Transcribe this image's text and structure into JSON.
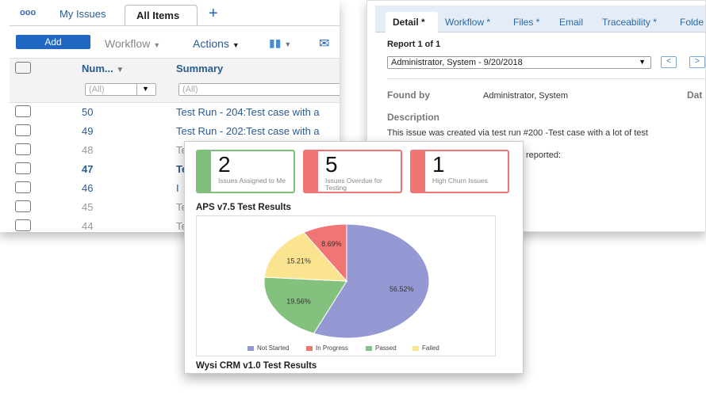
{
  "issues": {
    "tabs": [
      {
        "label": "ooo"
      },
      {
        "label": "My Issues"
      },
      {
        "label": "All Items"
      },
      {
        "label": "+"
      }
    ],
    "toolbar": {
      "add": "Add",
      "workflow": "Workflow",
      "actions": "Actions"
    },
    "columns": {
      "number": "Num...",
      "summary": "Summary"
    },
    "filters": {
      "number": "(All)",
      "summary": "(All)"
    },
    "rows": [
      {
        "number": "50",
        "summary": "Test Run - 204:Test case with a"
      },
      {
        "number": "49",
        "summary": "Test Run - 202:Test case with a"
      },
      {
        "number": "48",
        "summary": "Te"
      },
      {
        "number": "47",
        "summary": "Te"
      },
      {
        "number": "46",
        "summary": "I"
      },
      {
        "number": "45",
        "summary": "Te"
      },
      {
        "number": "44",
        "summary": "Te"
      }
    ]
  },
  "detail": {
    "tabs": [
      {
        "label": "Detail *"
      },
      {
        "label": "Workflow *"
      },
      {
        "label": "Files *"
      },
      {
        "label": "Email"
      },
      {
        "label": "Traceability *"
      },
      {
        "label": "Folde"
      }
    ],
    "report_label": "Report 1 of 1",
    "report_select": "Administrator, System - 9/20/2018",
    "prev": "<",
    "next": ">",
    "found_by_label": "Found by",
    "found_by_value": "Administrator, System",
    "date_label": "Dat",
    "description_label": "Description",
    "description": "This issue was created via test run #200 -Test case with a lot of test",
    "reported": "reported:"
  },
  "dashboard": {
    "cards": [
      {
        "value": "2",
        "label": "Issues Assigned to Me",
        "color": "#7fbf7a"
      },
      {
        "value": "5",
        "label": "Issues Overdue for Testing",
        "color": "#ef7474"
      },
      {
        "value": "1",
        "label": "High Churn Issues",
        "color": "#ef7474"
      }
    ],
    "chart_title": "APS v7.5 Test Results",
    "next_title": "Wysi CRM v1.0 Test Results"
  },
  "chart_data": {
    "type": "pie",
    "title": "APS v7.5 Test Results",
    "slices": [
      {
        "name": "Not Started",
        "value": 56.52,
        "label": "56.52%",
        "color": "#9499d3"
      },
      {
        "name": "Passed",
        "value": 19.56,
        "label": "19.56%",
        "color": "#85c17e"
      },
      {
        "name": "Failed",
        "value": 15.21,
        "label": "15.21%",
        "color": "#fbe48f"
      },
      {
        "name": "In Progress",
        "value": 8.69,
        "label": "8.69%",
        "color": "#f07575"
      }
    ],
    "legend": {
      "position": "bottom",
      "order": [
        "Not Started",
        "In Progress",
        "Passed",
        "Failed"
      ]
    }
  }
}
